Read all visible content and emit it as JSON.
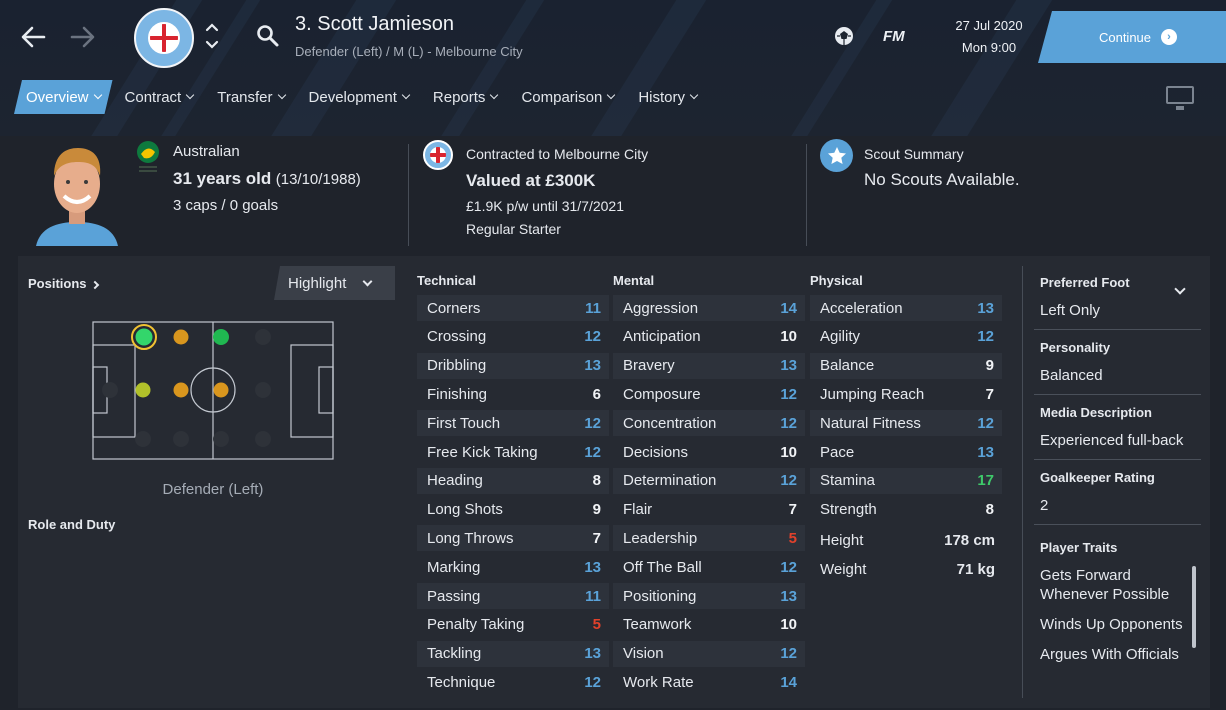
{
  "header": {
    "back_icon": "arrow-left-icon",
    "forward_icon": "arrow-right-icon",
    "title": "3. Scott Jamieson",
    "subtitle": "Defender (Left) / M (L) - Melbourne City",
    "date": "27 Jul 2020",
    "time": "Mon 9:00",
    "continue_label": "Continue",
    "fm_label": "FM",
    "badge_text": "MELBOURNE CITY FOOTBALL CLUB"
  },
  "tabs": [
    {
      "label": "Overview",
      "active": true
    },
    {
      "label": "Contract"
    },
    {
      "label": "Transfer"
    },
    {
      "label": "Development"
    },
    {
      "label": "Reports"
    },
    {
      "label": "Comparison"
    },
    {
      "label": "History"
    }
  ],
  "profile": {
    "nationality": "Australian",
    "age": "31 years old",
    "dob": "(13/10/1988)",
    "caps": "3 caps / 0 goals"
  },
  "contract": {
    "club": "Contracted to Melbourne City",
    "value": "Valued at £300K",
    "wage": "£1.9K p/w until 31/7/2021",
    "status": "Regular Starter"
  },
  "scout": {
    "title": "Scout Summary",
    "text": "No Scouts Available."
  },
  "positions": {
    "title": "Positions",
    "highlight": "Highlight",
    "role_text": "Defender (Left)",
    "role_duty": "Role and Duty"
  },
  "colors": {
    "accent": "#5aa2d8",
    "good": "#3ec96a",
    "bad": "#e2412b",
    "value_blue": "#5aa2d8"
  },
  "technical": {
    "title": "Technical",
    "items": [
      {
        "name": "Corners",
        "value": "11",
        "tone": "blue"
      },
      {
        "name": "Crossing",
        "value": "12",
        "tone": "blue"
      },
      {
        "name": "Dribbling",
        "value": "13",
        "tone": "blue"
      },
      {
        "name": "Finishing",
        "value": "6",
        "tone": "white"
      },
      {
        "name": "First Touch",
        "value": "12",
        "tone": "blue"
      },
      {
        "name": "Free Kick Taking",
        "value": "12",
        "tone": "blue"
      },
      {
        "name": "Heading",
        "value": "8",
        "tone": "white"
      },
      {
        "name": "Long Shots",
        "value": "9",
        "tone": "white"
      },
      {
        "name": "Long Throws",
        "value": "7",
        "tone": "white"
      },
      {
        "name": "Marking",
        "value": "13",
        "tone": "blue"
      },
      {
        "name": "Passing",
        "value": "11",
        "tone": "blue"
      },
      {
        "name": "Penalty Taking",
        "value": "5",
        "tone": "red"
      },
      {
        "name": "Tackling",
        "value": "13",
        "tone": "blue"
      },
      {
        "name": "Technique",
        "value": "12",
        "tone": "blue"
      }
    ]
  },
  "mental": {
    "title": "Mental",
    "items": [
      {
        "name": "Aggression",
        "value": "14",
        "tone": "blue"
      },
      {
        "name": "Anticipation",
        "value": "10",
        "tone": "white"
      },
      {
        "name": "Bravery",
        "value": "13",
        "tone": "blue"
      },
      {
        "name": "Composure",
        "value": "12",
        "tone": "blue"
      },
      {
        "name": "Concentration",
        "value": "12",
        "tone": "blue"
      },
      {
        "name": "Decisions",
        "value": "10",
        "tone": "white"
      },
      {
        "name": "Determination",
        "value": "12",
        "tone": "blue"
      },
      {
        "name": "Flair",
        "value": "7",
        "tone": "white"
      },
      {
        "name": "Leadership",
        "value": "5",
        "tone": "red"
      },
      {
        "name": "Off The Ball",
        "value": "12",
        "tone": "blue"
      },
      {
        "name": "Positioning",
        "value": "13",
        "tone": "blue"
      },
      {
        "name": "Teamwork",
        "value": "10",
        "tone": "white"
      },
      {
        "name": "Vision",
        "value": "12",
        "tone": "blue"
      },
      {
        "name": "Work Rate",
        "value": "14",
        "tone": "blue"
      }
    ]
  },
  "physical": {
    "title": "Physical",
    "items": [
      {
        "name": "Acceleration",
        "value": "13",
        "tone": "blue"
      },
      {
        "name": "Agility",
        "value": "12",
        "tone": "blue"
      },
      {
        "name": "Balance",
        "value": "9",
        "tone": "white"
      },
      {
        "name": "Jumping Reach",
        "value": "7",
        "tone": "white"
      },
      {
        "name": "Natural Fitness",
        "value": "12",
        "tone": "blue"
      },
      {
        "name": "Pace",
        "value": "13",
        "tone": "blue"
      },
      {
        "name": "Stamina",
        "value": "17",
        "tone": "green"
      },
      {
        "name": "Strength",
        "value": "8",
        "tone": "white"
      }
    ],
    "height_label": "Height",
    "height": "178 cm",
    "weight_label": "Weight",
    "weight": "71 kg"
  },
  "sidebar": {
    "preferred_foot_label": "Preferred Foot",
    "preferred_foot": "Left Only",
    "personality_label": "Personality",
    "personality": "Balanced",
    "media_label": "Media Description",
    "media": "Experienced full-back",
    "gk_label": "Goalkeeper Rating",
    "gk": "2",
    "traits_label": "Player Traits",
    "traits": [
      "Gets Forward Whenever Possible",
      "Winds Up Opponents",
      "Argues With Officials"
    ]
  }
}
